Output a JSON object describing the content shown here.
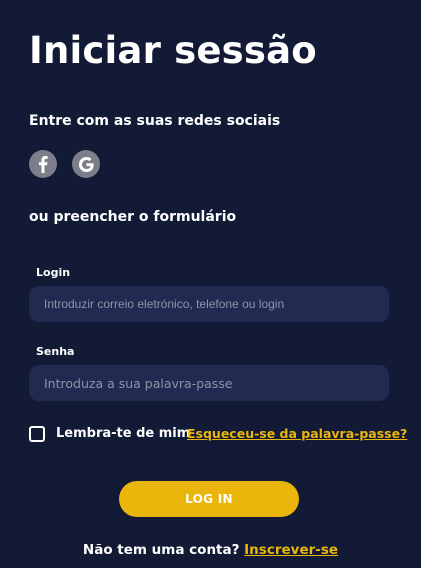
{
  "page": {
    "title": "Iniciar sessão"
  },
  "social": {
    "caption": "Entre com as suas redes sociais",
    "buttons": [
      {
        "icon": "facebook-icon",
        "glyph": "f"
      },
      {
        "icon": "google-icon",
        "glyph": "G"
      }
    ]
  },
  "form": {
    "caption": "ou preencher o formulário",
    "login": {
      "label": "Login",
      "value": "",
      "placeholder": "Introduzir correio eletrónico, telefone ou login"
    },
    "password": {
      "label": "Senha",
      "value": "",
      "placeholder": "Introduza a sua palavra-passe"
    },
    "remember": {
      "label": "Lembra-te de mim",
      "checked": false
    },
    "forgot_link": "Esqueceu-se da palavra-passe?",
    "submit_label": "LOG IN"
  },
  "signup": {
    "prompt": "Não tem uma conta?",
    "link": "Inscrever-se"
  },
  "colors": {
    "background": "#121a36",
    "input_background": "#212b52",
    "accent": "#eab60c",
    "social_button": "#7c7f8a",
    "text": "#ffffff",
    "placeholder": "#8e93a8"
  }
}
